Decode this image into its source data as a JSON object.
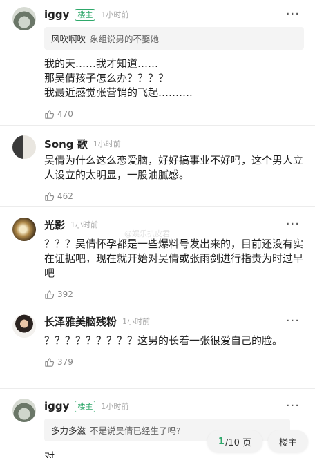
{
  "comments": [
    {
      "user": "iggy",
      "badge": "楼主",
      "time": "1小时前",
      "quote": {
        "name": "风吹啊吹",
        "text": "象组说男的不娶她"
      },
      "body": "我的天……我才知道……\n那吴倩孩子怎么办？？？？\n我最近感觉张营销的飞起……….",
      "likes": "470"
    },
    {
      "user": "Song 歌",
      "time": "1小时前",
      "body": "吴倩为什么这么恋爱脑，好好搞事业不好吗，这个男人立人设立的太明显，一股油腻感。",
      "likes": "462"
    },
    {
      "user": "光影",
      "time": "1小时前",
      "body": "？？？吴倩怀孕都是一些爆料号发出来的，目前还没有实在证据吧，现在就开始对吴倩或张雨剑进行指责为时过早吧",
      "likes": "392"
    },
    {
      "user": "长泽雅美脑残粉",
      "time": "1小时前",
      "body": "？？？？？？？？？这男的长着一张很爱自己的脸。",
      "likes": "379"
    },
    {
      "user": "iggy",
      "badge": "楼主",
      "time": "1小时前",
      "quote": {
        "name": "多力多滋",
        "text": "不是说吴倩已经生了吗?"
      },
      "body": "对……..",
      "likes": ""
    }
  ],
  "pager": {
    "current": "1",
    "total": "/10 页",
    "op_button": "楼主"
  },
  "watermark": "@娱乐扒皮君",
  "colors": {
    "accent": "#2ea86a"
  }
}
